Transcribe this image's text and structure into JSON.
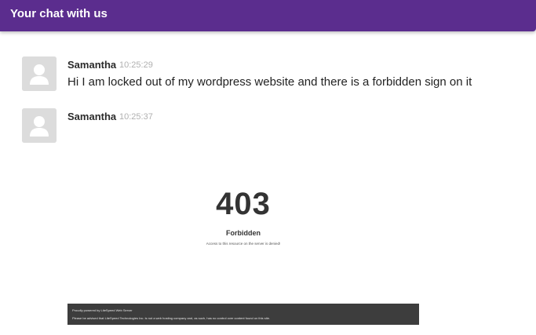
{
  "header": {
    "title": "Your chat with us",
    "background": "#5b2d8e"
  },
  "messages": [
    {
      "sender": "Samantha",
      "time": "10:25:29",
      "text": "Hi I am locked out of my wordpress website and there is a forbidden sign on it",
      "avatar_icon": "user-silhouette-icon"
    },
    {
      "sender": "Samantha",
      "time": "10:25:37",
      "avatar_icon": "user-silhouette-icon",
      "attachment": {
        "code": "403",
        "title": "Forbidden",
        "description": "Access to this resource on the server is denied!",
        "footer_line_1": "Proudly powered by LiteSpeed Web Server",
        "footer_line_2": "Please be advised that LiteSpeed Technologies Inc. is not a web hosting company and, as such, has no control over content found on this site."
      }
    }
  ]
}
